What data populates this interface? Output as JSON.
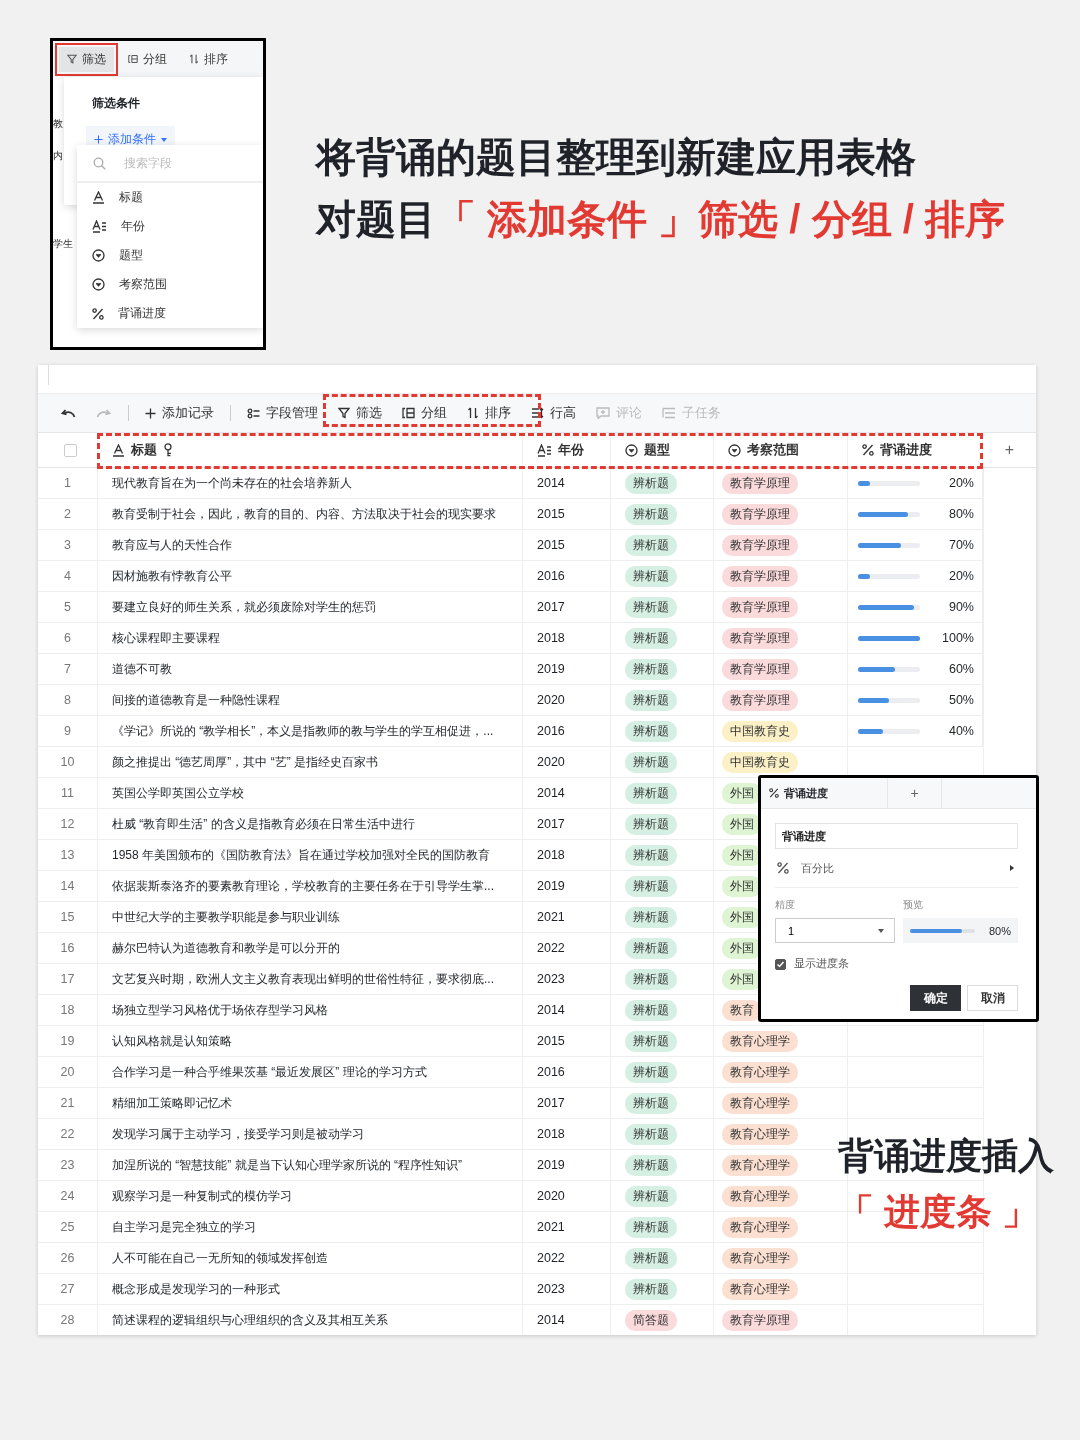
{
  "inset": {
    "toolbar": [
      {
        "kind": "filter",
        "label": "筛选",
        "selected": true
      },
      {
        "kind": "group",
        "label": "分组",
        "selected": false
      },
      {
        "kind": "sort",
        "label": "排序",
        "selected": false
      }
    ],
    "row_fragments": [
      "教",
      "内",
      "学生"
    ],
    "panel": {
      "title": "筛选条件",
      "add_button": "添加条件",
      "search": {
        "placeholder": "搜索字段"
      },
      "fields": [
        {
          "kind": "text",
          "label": "标题"
        },
        {
          "kind": "year",
          "label": "年份"
        },
        {
          "kind": "select",
          "label": "题型"
        },
        {
          "kind": "select",
          "label": "考察范围"
        },
        {
          "kind": "percent",
          "label": "背诵进度"
        }
      ]
    }
  },
  "headline": {
    "line1": "将背诵的题目整理到新建应用表格",
    "line2": [
      {
        "text": "对题目",
        "highlight": false
      },
      {
        "text": "「 添加条件 」筛选 / 分组 / 排序",
        "highlight": true
      }
    ]
  },
  "toolbar": [
    [
      {
        "kind": "undo",
        "disabled": false
      },
      {
        "kind": "redo",
        "disabled": true
      }
    ],
    [
      {
        "kind": "add",
        "label": "添加记录",
        "disabled": false
      }
    ],
    [
      {
        "kind": "fields",
        "label": "字段管理",
        "disabled": false
      },
      {
        "kind": "filter",
        "label": "筛选",
        "disabled": false
      },
      {
        "kind": "group",
        "label": "分组",
        "disabled": false
      },
      {
        "kind": "sort",
        "label": "排序",
        "disabled": false
      },
      {
        "kind": "rowheight",
        "label": "行高",
        "disabled": false
      },
      {
        "kind": "comment",
        "label": "评论",
        "disabled": true
      },
      {
        "kind": "subtask",
        "label": "子任务",
        "disabled": true
      }
    ]
  ],
  "select_all": {
    "checked": false
  },
  "add_column": "+",
  "columns": [
    {
      "kind": "text",
      "label": "标题",
      "primary": true
    },
    {
      "kind": "year",
      "label": "年份",
      "primary": false
    },
    {
      "kind": "select",
      "label": "题型",
      "primary": false
    },
    {
      "kind": "select",
      "label": "考察范围",
      "primary": false
    },
    {
      "kind": "percent",
      "label": "背诵进度",
      "primary": false
    }
  ],
  "rows": [
    {
      "index": "1",
      "title": "现代教育旨在为一个尚未存在的社会培养新人",
      "year": "2014",
      "type": {
        "text": "辨析题",
        "color": "#d5f0e3"
      },
      "scope": {
        "text": "教育学原理",
        "color": "#fadadb"
      },
      "level": 0.2,
      "reading": "20%"
    },
    {
      "index": "2",
      "title": "教育受制于社会，因此，教育的目的、内容、方法取决于社会的现实要求",
      "year": "2015",
      "type": {
        "text": "辨析题",
        "color": "#d5f0e3"
      },
      "scope": {
        "text": "教育学原理",
        "color": "#fadadb"
      },
      "level": 0.8,
      "reading": "80%"
    },
    {
      "index": "3",
      "title": "教育应与人的天性合作",
      "year": "2015",
      "type": {
        "text": "辨析题",
        "color": "#d5f0e3"
      },
      "scope": {
        "text": "教育学原理",
        "color": "#fadadb"
      },
      "level": 0.7,
      "reading": "70%"
    },
    {
      "index": "4",
      "title": "因材施教有悖教育公平",
      "year": "2016",
      "type": {
        "text": "辨析题",
        "color": "#d5f0e3"
      },
      "scope": {
        "text": "教育学原理",
        "color": "#fadadb"
      },
      "level": 0.2,
      "reading": "20%"
    },
    {
      "index": "5",
      "title": "要建立良好的师生关系，就必须废除对学生的惩罚",
      "year": "2017",
      "type": {
        "text": "辨析题",
        "color": "#d5f0e3"
      },
      "scope": {
        "text": "教育学原理",
        "color": "#fadadb"
      },
      "level": 0.9,
      "reading": "90%"
    },
    {
      "index": "6",
      "title": "核心课程即主要课程",
      "year": "2018",
      "type": {
        "text": "辨析题",
        "color": "#d5f0e3"
      },
      "scope": {
        "text": "教育学原理",
        "color": "#fadadb"
      },
      "level": 1,
      "reading": "100%"
    },
    {
      "index": "7",
      "title": "道德不可教",
      "year": "2019",
      "type": {
        "text": "辨析题",
        "color": "#d5f0e3"
      },
      "scope": {
        "text": "教育学原理",
        "color": "#fadadb"
      },
      "level": 0.6,
      "reading": "60%"
    },
    {
      "index": "8",
      "title": "间接的道德教育是一种隐性课程",
      "year": "2020",
      "type": {
        "text": "辨析题",
        "color": "#d5f0e3"
      },
      "scope": {
        "text": "教育学原理",
        "color": "#fadadb"
      },
      "level": 0.5,
      "reading": "50%"
    },
    {
      "index": "9",
      "title": "《学记》所说的 “教学相长”，本义是指教师的教与学生的学互相促进，...",
      "year": "2016",
      "type": {
        "text": "辨析题",
        "color": "#d5f0e3"
      },
      "scope": {
        "text": "中国教育史",
        "color": "#fbf0c6"
      },
      "level": 0.4,
      "reading": "40%"
    },
    {
      "index": "10",
      "title": "颜之推提出 “德艺周厚”，其中 “艺” 是指经史百家书",
      "year": "2020",
      "type": {
        "text": "辨析题",
        "color": "#d5f0e3"
      },
      "scope": {
        "text": "中国教育史",
        "color": "#fbf0c6"
      }
    },
    {
      "index": "11",
      "title": "英国公学即英国公立学校",
      "year": "2014",
      "type": {
        "text": "辨析题",
        "color": "#d5f0e3"
      },
      "scope": {
        "text": "外国",
        "color": "#def4d2"
      }
    },
    {
      "index": "12",
      "title": "杜威 “教育即生活” 的含义是指教育必须在日常生活中进行",
      "year": "2017",
      "type": {
        "text": "辨析题",
        "color": "#d5f0e3"
      },
      "scope": {
        "text": "外国",
        "color": "#def4d2"
      }
    },
    {
      "index": "13",
      "title": "1958 年美国颁布的《国防教育法》旨在通过学校加强对全民的国防教育",
      "year": "2018",
      "type": {
        "text": "辨析题",
        "color": "#d5f0e3"
      },
      "scope": {
        "text": "外国",
        "color": "#def4d2"
      }
    },
    {
      "index": "14",
      "title": "依据裴斯泰洛齐的要素教育理论，学校教育的主要任务在于引导学生掌...",
      "year": "2019",
      "type": {
        "text": "辨析题",
        "color": "#d5f0e3"
      },
      "scope": {
        "text": "外国",
        "color": "#def4d2"
      }
    },
    {
      "index": "15",
      "title": "中世纪大学的主要教学职能是参与职业训练",
      "year": "2021",
      "type": {
        "text": "辨析题",
        "color": "#d5f0e3"
      },
      "scope": {
        "text": "外国",
        "color": "#def4d2"
      }
    },
    {
      "index": "16",
      "title": "赫尔巴特认为道德教育和教学是可以分开的",
      "year": "2022",
      "type": {
        "text": "辨析题",
        "color": "#d5f0e3"
      },
      "scope": {
        "text": "外国",
        "color": "#def4d2"
      }
    },
    {
      "index": "17",
      "title": "文艺复兴时期，欧洲人文主义教育表现出鲜明的世俗性特征，要求彻底...",
      "year": "2023",
      "type": {
        "text": "辨析题",
        "color": "#d5f0e3"
      },
      "scope": {
        "text": "外国",
        "color": "#def4d2"
      }
    },
    {
      "index": "18",
      "title": "场独立型学习风格优于场依存型学习风格",
      "year": "2014",
      "type": {
        "text": "辨析题",
        "color": "#d5f0e3"
      },
      "scope": {
        "text": "教育",
        "color": "#fbe0d2"
      }
    },
    {
      "index": "19",
      "title": "认知风格就是认知策略",
      "year": "2015",
      "type": {
        "text": "辨析题",
        "color": "#d5f0e3"
      },
      "scope": {
        "text": "教育心理学",
        "color": "#fbe0d2"
      }
    },
    {
      "index": "20",
      "title": "合作学习是一种合乎维果茨基 “最近发展区” 理论的学习方式",
      "year": "2016",
      "type": {
        "text": "辨析题",
        "color": "#d5f0e3"
      },
      "scope": {
        "text": "教育心理学",
        "color": "#fbe0d2"
      }
    },
    {
      "index": "21",
      "title": "精细加工策略即记忆术",
      "year": "2017",
      "type": {
        "text": "辨析题",
        "color": "#d5f0e3"
      },
      "scope": {
        "text": "教育心理学",
        "color": "#fbe0d2"
      }
    },
    {
      "index": "22",
      "title": "发现学习属于主动学习，接受学习则是被动学习",
      "year": "2018",
      "type": {
        "text": "辨析题",
        "color": "#d5f0e3"
      },
      "scope": {
        "text": "教育心理学",
        "color": "#fbe0d2"
      }
    },
    {
      "index": "23",
      "title": "加涅所说的 “智慧技能” 就是当下认知心理学家所说的 “程序性知识”",
      "year": "2019",
      "type": {
        "text": "辨析题",
        "color": "#d5f0e3"
      },
      "scope": {
        "text": "教育心理学",
        "color": "#fbe0d2"
      }
    },
    {
      "index": "24",
      "title": "观察学习是一种复制式的模仿学习",
      "year": "2020",
      "type": {
        "text": "辨析题",
        "color": "#d5f0e3"
      },
      "scope": {
        "text": "教育心理学",
        "color": "#fbe0d2"
      }
    },
    {
      "index": "25",
      "title": "自主学习是完全独立的学习",
      "year": "2021",
      "type": {
        "text": "辨析题",
        "color": "#d5f0e3"
      },
      "scope": {
        "text": "教育心理学",
        "color": "#fbe0d2"
      }
    },
    {
      "index": "26",
      "title": "人不可能在自己一无所知的领域发挥创造",
      "year": "2022",
      "type": {
        "text": "辨析题",
        "color": "#d5f0e3"
      },
      "scope": {
        "text": "教育心理学",
        "color": "#fbe0d2"
      }
    },
    {
      "index": "27",
      "title": "概念形成是发现学习的一种形式",
      "year": "2023",
      "type": {
        "text": "辨析题",
        "color": "#d5f0e3"
      },
      "scope": {
        "text": "教育心理学",
        "color": "#fbe0d2"
      }
    },
    {
      "index": "28",
      "title": "简述课程的逻辑组织与心理组织的含义及其相互关系",
      "year": "2014",
      "type": {
        "text": "简答题",
        "color": "#fadadb"
      },
      "scope": {
        "text": "教育学原理",
        "color": "#fadadb"
      }
    }
  ],
  "field_popup": {
    "tab": "背诵进度",
    "add_tab": "+",
    "field_name": "背诵进度",
    "format": "百分比",
    "precision_label": "精度",
    "preview_label": "预览",
    "precision": "1",
    "preview": {
      "level": 0.8,
      "reading": "80%"
    },
    "show_bar": {
      "label": "显示进度条",
      "checked": true
    },
    "buttons": [
      {
        "kind": "primary",
        "label": "确定"
      },
      {
        "kind": "secondary",
        "label": "取消"
      }
    ]
  },
  "callout": {
    "line1": "背诵进度插入",
    "line2": "「 进度条 」"
  }
}
